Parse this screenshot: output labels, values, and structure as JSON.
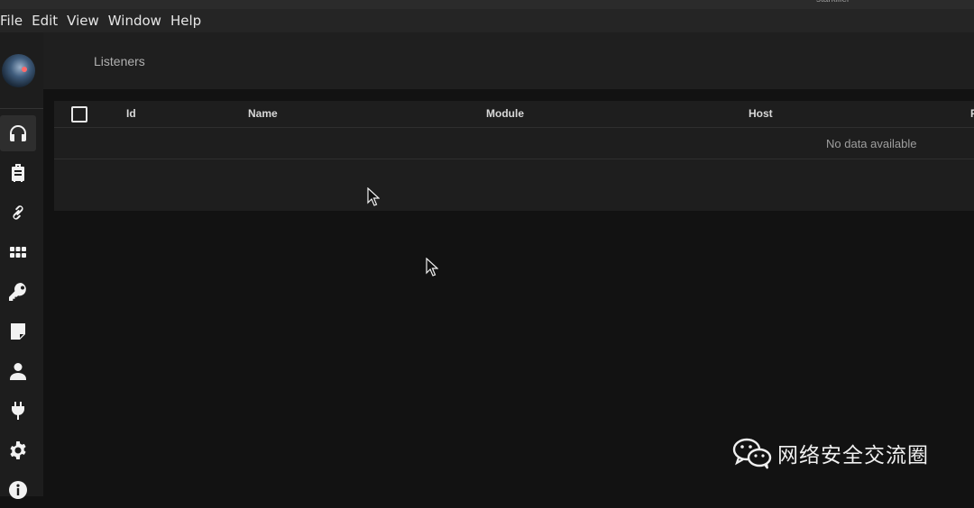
{
  "window": {
    "user_label": "starkiller"
  },
  "menubar": {
    "items": [
      "File",
      "Edit",
      "View",
      "Window",
      "Help"
    ]
  },
  "sidebar": {
    "nav": [
      {
        "icon": "headphones-icon",
        "active": true
      },
      {
        "icon": "briefcase-icon",
        "active": false
      },
      {
        "icon": "link-icon",
        "active": false
      },
      {
        "icon": "grid-icon",
        "active": false
      },
      {
        "icon": "key-icon",
        "active": false
      },
      {
        "icon": "note-icon",
        "active": false
      },
      {
        "icon": "user-icon",
        "active": false
      },
      {
        "icon": "plug-icon",
        "active": false
      },
      {
        "icon": "gear-icon",
        "active": false
      },
      {
        "icon": "info-icon",
        "active": false
      }
    ]
  },
  "page": {
    "title": "Listeners"
  },
  "table": {
    "columns": [
      "Id",
      "Name",
      "Module",
      "Host",
      "P"
    ],
    "empty_text": "No data available"
  },
  "watermark": {
    "text": "网络安全交流圈",
    "icon": "wechat-icon"
  },
  "colors": {
    "background": "#121212",
    "sidebar": "#1d1d1d",
    "card": "#1e1e1e"
  }
}
